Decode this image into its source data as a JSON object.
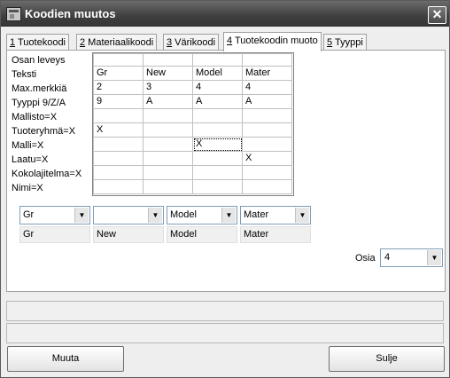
{
  "window": {
    "title": "Koodien muutos",
    "close_glyph": "✕"
  },
  "tabs": [
    {
      "key": "1",
      "label": " Tuotekoodi"
    },
    {
      "key": "2",
      "label": " Materiaalikoodi"
    },
    {
      "key": "3",
      "label": " Värikoodi"
    },
    {
      "key": "4",
      "label": " Tuotekoodin muoto"
    },
    {
      "key": "5",
      "label": " Tyyppi"
    }
  ],
  "row_labels": [
    "Osan leveys",
    "Teksti",
    "Max.merkkiä",
    "Tyyppi 9/Z/A",
    "Mallisto=X",
    "Tuoteryhmä=X",
    "Malli=X",
    "Laatu=X",
    "Kokolajitelma=X",
    "Nimi=X"
  ],
  "grid": {
    "rows": [
      [
        "",
        "",
        "",
        ""
      ],
      [
        "Gr",
        "New",
        "Model",
        "Mater"
      ],
      [
        "2",
        "3",
        "4",
        "4"
      ],
      [
        "9",
        "A",
        "A",
        "A"
      ],
      [
        "",
        "",
        "",
        ""
      ],
      [
        "X",
        "",
        "",
        ""
      ],
      [
        "",
        "",
        "X",
        ""
      ],
      [
        "",
        "",
        "",
        "X"
      ],
      [
        "",
        "",
        "",
        ""
      ],
      [
        "",
        "",
        "",
        ""
      ]
    ]
  },
  "combos": [
    {
      "value": "Gr",
      "label": "Gr"
    },
    {
      "value": "",
      "label": "New"
    },
    {
      "value": "Model",
      "label": "Model"
    },
    {
      "value": "Mater",
      "label": "Mater"
    }
  ],
  "osia": {
    "label": "Osia",
    "value": "4"
  },
  "buttons": {
    "muuta": "Muuta",
    "sulje": "Sulje"
  }
}
